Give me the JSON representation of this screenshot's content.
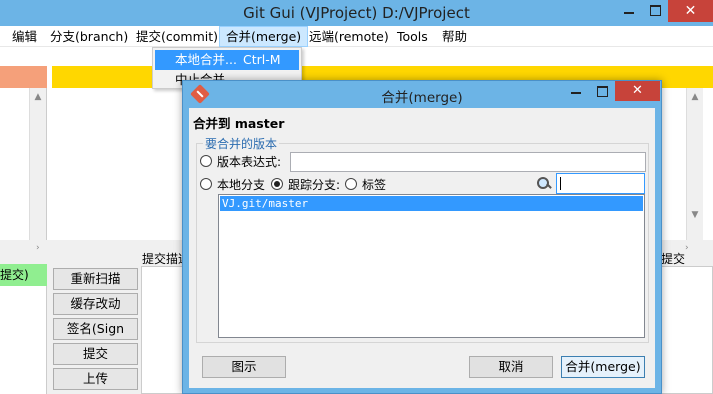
{
  "window": {
    "title": "Git Gui (VJProject) D:/VJProject",
    "close_glyph": "✕"
  },
  "menubar": {
    "items": [
      {
        "label": "编辑"
      },
      {
        "label": "分支(branch)"
      },
      {
        "label": "提交(commit)"
      },
      {
        "label": "合并(merge)"
      },
      {
        "label": "远端(remote)"
      },
      {
        "label": "Tools"
      },
      {
        "label": "帮助"
      }
    ],
    "active_index": 3
  },
  "merge_menu": {
    "items": [
      {
        "label": "本地合并...",
        "shortcut": "Ctrl-M",
        "highlighted": true
      },
      {
        "label": "中止合并",
        "shortcut": "",
        "highlighted": false
      }
    ]
  },
  "background": {
    "left_badge": "提交)",
    "commit_desc_label": "提交描述",
    "commit_right_label": "提交",
    "buttons": [
      "重新扫描",
      "缓存改动",
      "签名(Sign Off)",
      "提交",
      "上传"
    ],
    "colors": {
      "staged_header": "#f5a07a",
      "diff_header": "#ffd700",
      "badge": "#90ee90"
    }
  },
  "dialog": {
    "title": "合并(merge)",
    "close_glyph": "✕",
    "heading": "合并到 master",
    "group_label": "要合并的版本",
    "options": {
      "expression_label": "版本表达式:",
      "expression_value": "",
      "local_branch_label": "本地分支",
      "tracking_branch_label": "跟踪分支:",
      "tag_label": "标签",
      "selected": "tracking_branch"
    },
    "filter_value": "",
    "branches": [
      "VJ.git/master"
    ],
    "selected_branch": "VJ.git/master",
    "buttons": {
      "visualize": "图示",
      "cancel": "取消",
      "merge": "合并(merge)"
    }
  }
}
